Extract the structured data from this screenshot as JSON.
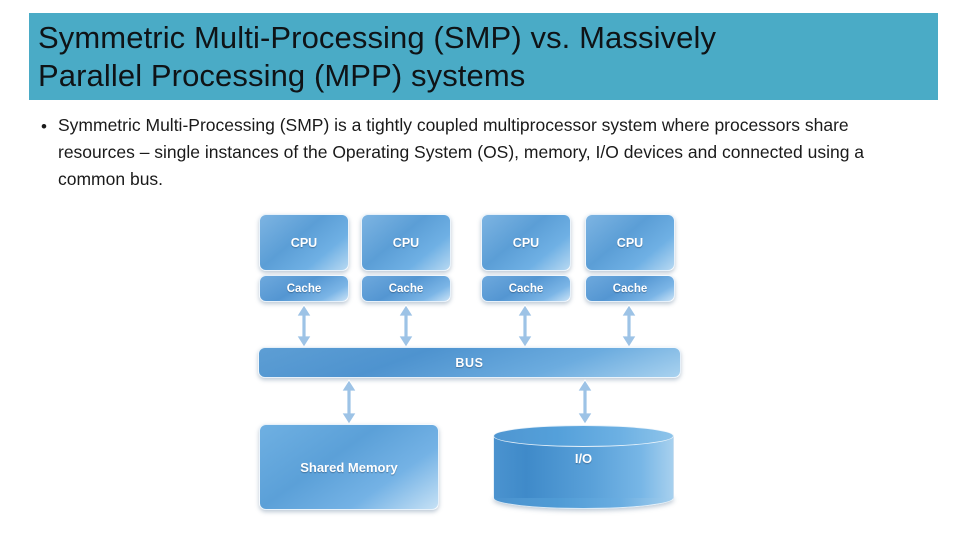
{
  "slide": {
    "title": "Symmetric Multi-Processing (SMP) vs. Massively\nParallel Processing (MPP) systems",
    "title_banner_color": "#4aabc6",
    "background_color": "#ffffff"
  },
  "body": {
    "bullets": [
      {
        "marker": "•",
        "text": "Symmetric Multi-Processing (SMP) is a tightly coupled multiprocessor system where processors share resources – single instances of the Operating System (OS), memory, I/O devices and connected using a common bus."
      }
    ]
  },
  "diagram": {
    "type": "smp-architecture",
    "accent_color": "#5b9ed6",
    "arrow_color": "#9dc3e6",
    "cpus": [
      {
        "cpu_label": "CPU",
        "cache_label": "Cache"
      },
      {
        "cpu_label": "CPU",
        "cache_label": "Cache"
      },
      {
        "cpu_label": "CPU",
        "cache_label": "Cache"
      },
      {
        "cpu_label": "CPU",
        "cache_label": "Cache"
      }
    ],
    "bus": {
      "label": "BUS"
    },
    "shared_memory": {
      "label": "Shared Memory"
    },
    "io": {
      "label": "I/O"
    }
  }
}
